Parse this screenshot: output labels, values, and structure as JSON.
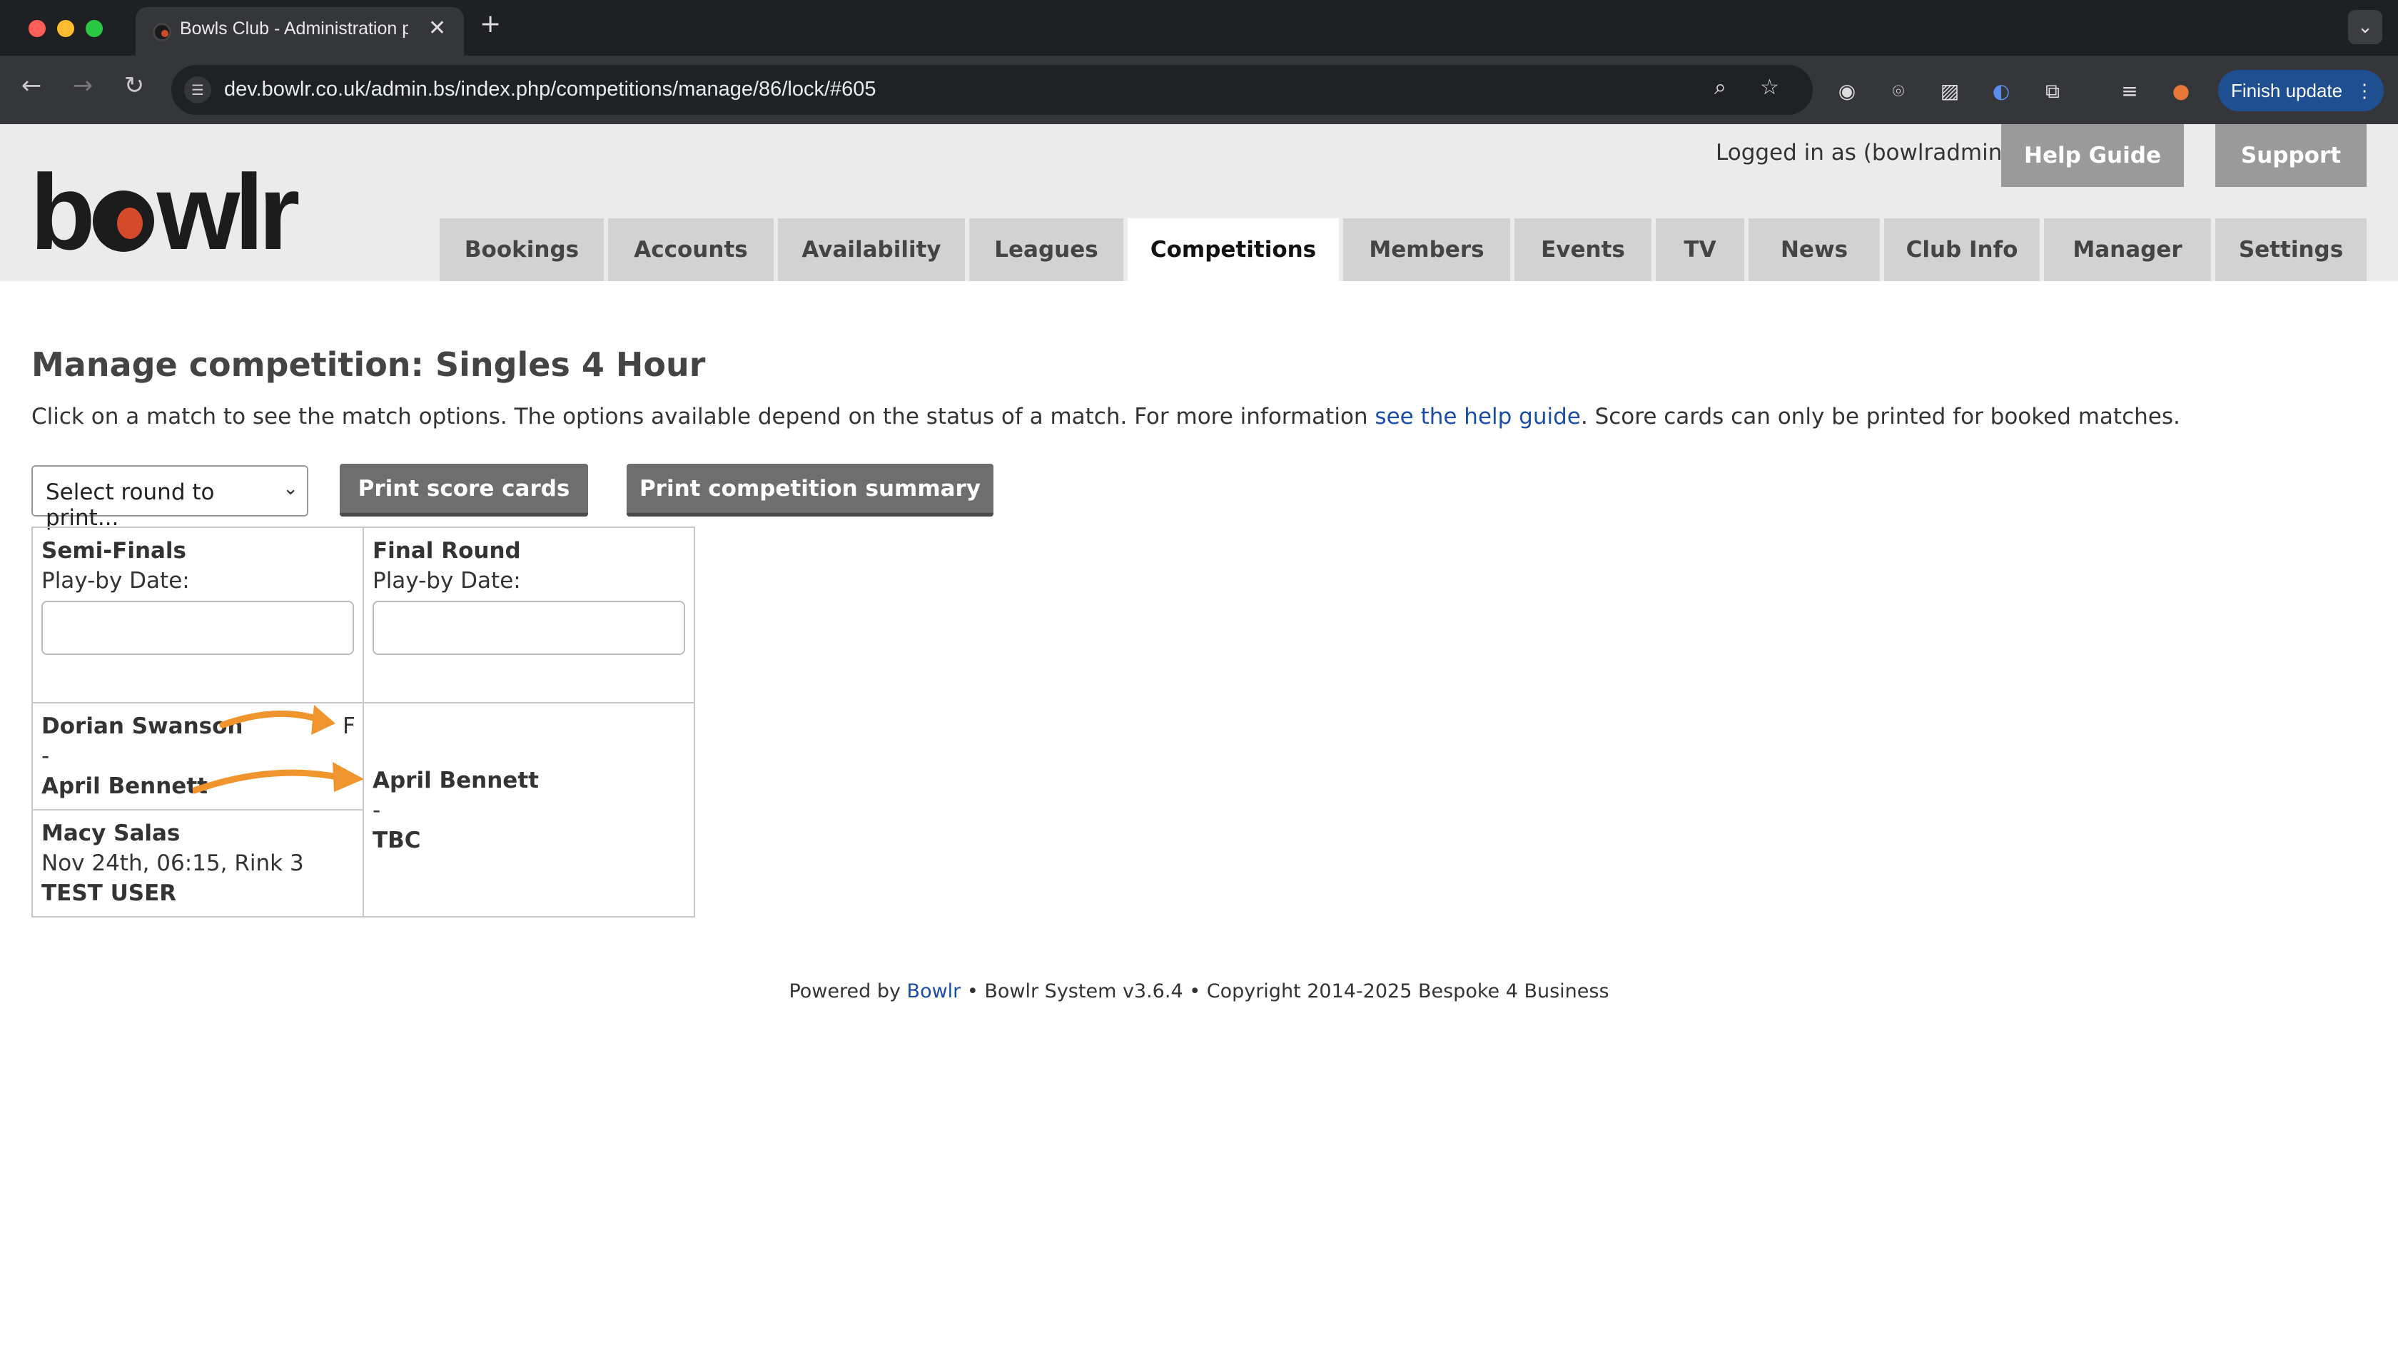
{
  "browser": {
    "tab_title": "Bowls Club - Administration p",
    "url": "dev.bowlr.co.uk/admin.bs/index.php/competitions/manage/86/lock/#605",
    "finish_update_label": "Finish update"
  },
  "header": {
    "logo_text_left": "b",
    "logo_text_right": "wlr",
    "logged_in": "Logged in as (bowlradmin)",
    "help_guide_label": "Help Guide",
    "support_label": "Support",
    "nav_tabs": [
      "Bookings",
      "Accounts",
      "Availability",
      "Leagues",
      "Competitions",
      "Members",
      "Events",
      "TV",
      "News",
      "Club Info",
      "Manager",
      "Settings"
    ],
    "active_tab": "Competitions"
  },
  "main": {
    "title": "Manage competition: Singles 4 Hour",
    "intro_before": "Click on a match to see the match options. The options available depend on the status of a match. For more information ",
    "intro_link": "see the help guide",
    "intro_after": ". Score cards can only be printed for booked matches.",
    "round_select_value": "Select round to print...",
    "print_score_cards_label": "Print score cards",
    "print_summary_label": "Print competition summary"
  },
  "bracket": {
    "rounds": [
      {
        "name": "Semi-Finals",
        "playby_label": "Play-by Date:",
        "playby_value": ""
      },
      {
        "name": "Final Round",
        "playby_label": "Play-by Date:",
        "playby_value": ""
      }
    ],
    "semi_match_1": {
      "player1": "Dorian Swanson",
      "flag": "F",
      "separator": "-",
      "player2": "April Bennett"
    },
    "semi_match_2": {
      "player1": "Macy Salas",
      "details": "Nov 24th, 06:15, Rink 3",
      "player2": "TEST USER"
    },
    "final_match": {
      "player1": "April Bennett",
      "separator": "-",
      "player2": "TBC"
    },
    "arrow_color": "#f0952e"
  },
  "footer": {
    "powered_by": "Powered by ",
    "bowlr_link": "Bowlr",
    "rest": " • Bowlr System v3.6.4 • Copyright 2014-2025 Bespoke 4 Business"
  }
}
